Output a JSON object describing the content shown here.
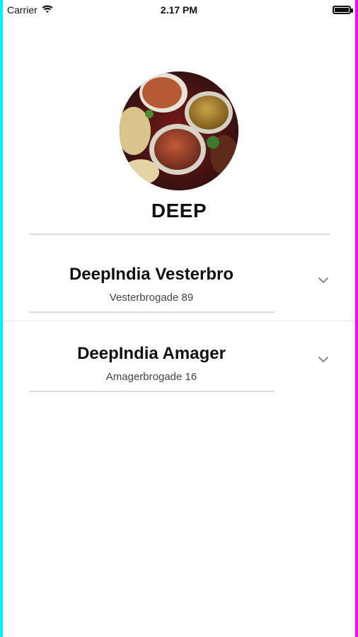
{
  "status_bar": {
    "carrier": "Carrier",
    "time": "2.17 PM"
  },
  "profile": {
    "image_alt": "food-dishes-photo",
    "title": "DEEP"
  },
  "locations": [
    {
      "name": "DeepIndia Vesterbro",
      "address": "Vesterbrogade 89"
    },
    {
      "name": "DeepIndia Amager",
      "address": "Amagerbrogade 16"
    }
  ],
  "colors": {
    "left_edge": "#00f0ff",
    "right_edge": "#ff00ff",
    "divider": "#dcdcdc"
  }
}
